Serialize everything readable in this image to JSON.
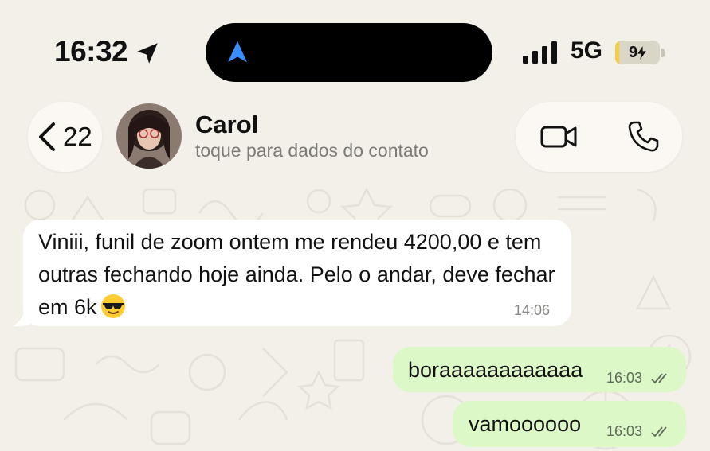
{
  "status_bar": {
    "time": "16:32",
    "network": "5G",
    "battery": "9",
    "battery_level": 0.09,
    "icons": [
      "location-arrow-icon",
      "navigation-icon",
      "signal-icon",
      "charging-bolt-icon"
    ]
  },
  "header": {
    "back_count": "22",
    "contact_name": "Carol",
    "contact_subtitle": "toque para dados do contato",
    "icons": [
      "chevron-left-icon",
      "video-call-icon",
      "phone-call-icon"
    ]
  },
  "messages": [
    {
      "direction": "incoming",
      "text": "Viniii, funil de zoom ontem me rendeu 4200,00 e tem outras fechando hoje ainda. Pelo o andar, deve fechar em 6k",
      "emoji": "😎",
      "time": "14:06"
    },
    {
      "direction": "outgoing",
      "text": "boraaaaaaaaaaaa",
      "time": "16:03",
      "status": "read"
    },
    {
      "direction": "outgoing",
      "text": "vamoooooo",
      "time": "16:03",
      "status": "read"
    }
  ],
  "colors": {
    "background": "#f3efe9",
    "incoming_bubble": "#ffffff",
    "outgoing_bubble": "#dcf8c6",
    "battery_fill": "#f5cd41",
    "nav_arrow": "#3a8dff"
  }
}
